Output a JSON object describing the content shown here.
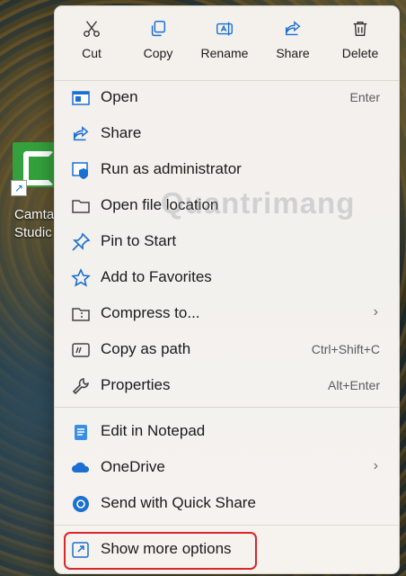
{
  "desktop": {
    "icon_label_line1": "Camta",
    "icon_label_line2": "Studic"
  },
  "toolbar": [
    {
      "label": "Cut",
      "icon": "scissors-icon"
    },
    {
      "label": "Copy",
      "icon": "copy-icon"
    },
    {
      "label": "Rename",
      "icon": "rename-icon"
    },
    {
      "label": "Share",
      "icon": "share-icon"
    },
    {
      "label": "Delete",
      "icon": "trash-icon"
    }
  ],
  "items": [
    {
      "label": "Open",
      "shortcut": "Enter",
      "icon": "open-icon"
    },
    {
      "label": "Share",
      "shortcut": "",
      "icon": "share-icon"
    },
    {
      "label": "Run as administrator",
      "shortcut": "",
      "icon": "shield-icon"
    },
    {
      "label": "Open file location",
      "shortcut": "",
      "icon": "folder-icon"
    },
    {
      "label": "Pin to Start",
      "shortcut": "",
      "icon": "pin-icon"
    },
    {
      "label": "Add to Favorites",
      "shortcut": "",
      "icon": "star-icon"
    },
    {
      "label": "Compress to...",
      "shortcut": "",
      "icon": "zip-icon",
      "submenu": true
    },
    {
      "label": "Copy as path",
      "shortcut": "Ctrl+Shift+C",
      "icon": "path-icon"
    },
    {
      "label": "Properties",
      "shortcut": "Alt+Enter",
      "icon": "wrench-icon"
    },
    {
      "label": "Edit in Notepad",
      "shortcut": "",
      "icon": "notepad-icon"
    },
    {
      "label": "OneDrive",
      "shortcut": "",
      "icon": "cloud-icon",
      "submenu": true
    },
    {
      "label": "Send with Quick Share",
      "shortcut": "",
      "icon": "quickshare-icon"
    },
    {
      "label": "Show more options",
      "shortcut": "",
      "icon": "more-options-icon"
    }
  ],
  "watermark": "Quantrimang",
  "colors": {
    "accent": "#1a6fd1",
    "highlight": "#d8262a"
  }
}
